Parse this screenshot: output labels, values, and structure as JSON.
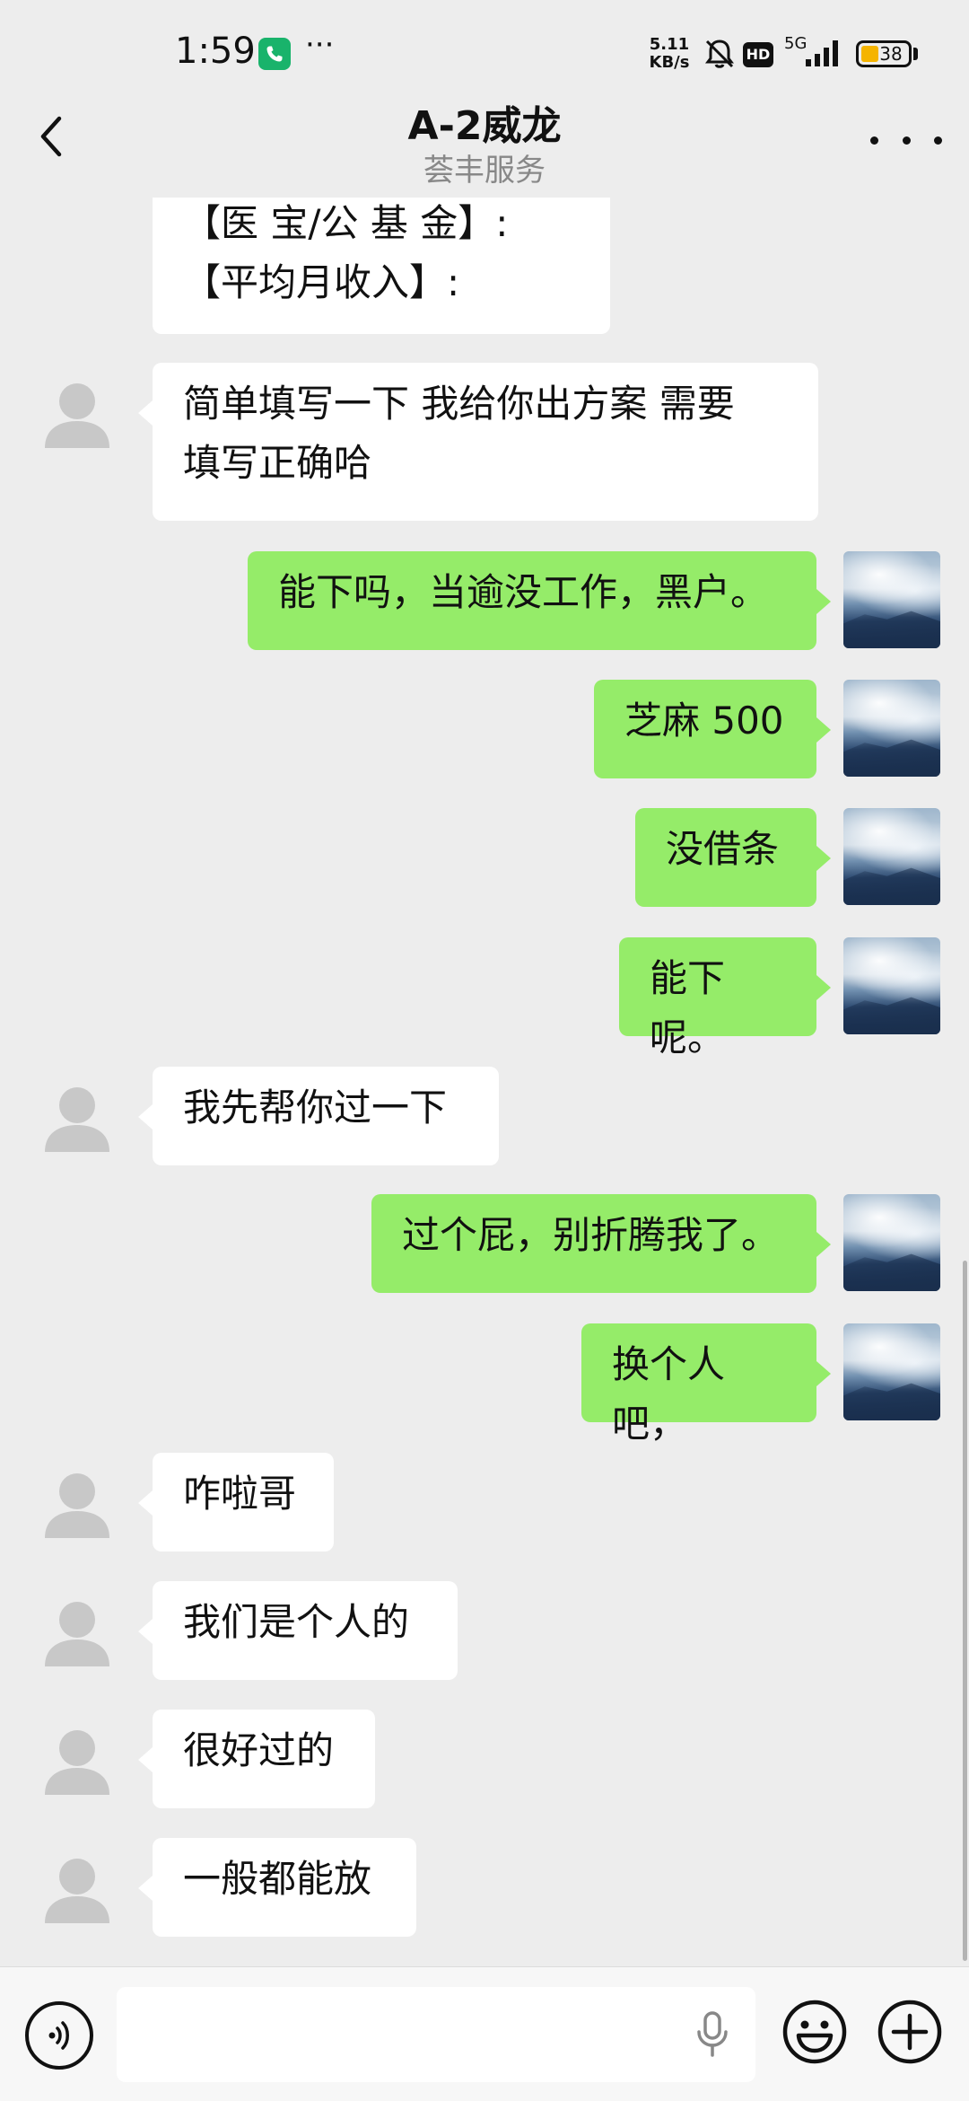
{
  "status_bar": {
    "time": "1:59",
    "dots": "···",
    "net_speed_value": "5.11",
    "net_speed_unit": "KB/s",
    "hd": "HD",
    "network": "5G",
    "battery": "38"
  },
  "header": {
    "title": "A-2威龙",
    "subtitle": "荟丰服务"
  },
  "messages": [
    {
      "side": "in",
      "text": "【医 宝/公 基 金】:\n【平均月收入】:"
    },
    {
      "side": "in",
      "text": "简单填写一下 我给你出方案 需要\n填写正确哈"
    },
    {
      "side": "out",
      "text": "能下吗，当逾没工作，黑户。"
    },
    {
      "side": "out",
      "text": "芝麻 500"
    },
    {
      "side": "out",
      "text": "没借条"
    },
    {
      "side": "out",
      "text": "能下呢。"
    },
    {
      "side": "in",
      "text": "我先帮你过一下"
    },
    {
      "side": "out",
      "text": "过个屁，别折腾我了。"
    },
    {
      "side": "out",
      "text": "换个人吧，"
    },
    {
      "side": "in",
      "text": "咋啦哥"
    },
    {
      "side": "in",
      "text": "我们是个人的"
    },
    {
      "side": "in",
      "text": "很好过的"
    },
    {
      "side": "in",
      "text": "一般都能放"
    }
  ],
  "input_bar": {
    "placeholder": ""
  },
  "colors": {
    "background": "#ededed",
    "incoming_bubble": "#ffffff",
    "outgoing_bubble": "#95ec69",
    "call_badge": "#19b36b",
    "battery": "#f5b400"
  },
  "icons": [
    "back-arrow-icon",
    "more-icon",
    "phone-icon",
    "mute-bell-icon",
    "signal-icon",
    "battery-icon",
    "voice-icon",
    "microphone-icon",
    "emoji-icon",
    "plus-icon",
    "default-avatar-icon",
    "landscape-avatar"
  ]
}
